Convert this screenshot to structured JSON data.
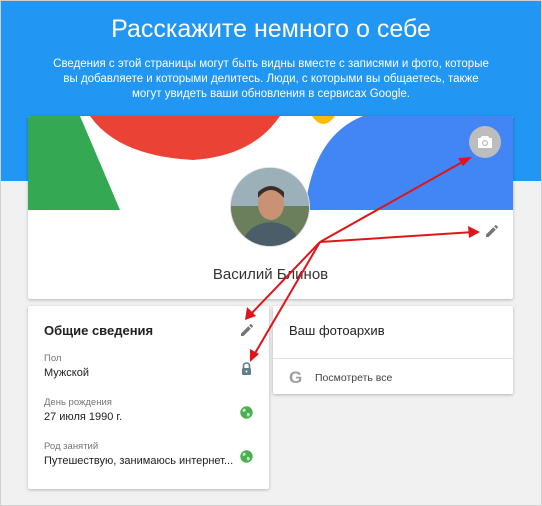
{
  "header": {
    "title": "Расскажите немного о себе",
    "description": "Сведения с этой страницы могут быть видны вместе с записями и фото, которые вы добавляете и которыми делитесь. Люди, с которыми вы общаетесь, также могут увидеть ваши обновления в сервисах Google."
  },
  "profile": {
    "name": "Василий Блинов",
    "avatar_icon": "user-photo",
    "change_cover_icon": "camera-icon",
    "edit_icon": "pencil-icon"
  },
  "general": {
    "title": "Общие сведения",
    "edit_icon": "pencil-icon",
    "fields": [
      {
        "label": "Пол",
        "value": "Мужской",
        "visibility_icon": "lock-icon"
      },
      {
        "label": "День рождения",
        "value": "27 июля 1990 г.",
        "visibility_icon": "globe-icon"
      },
      {
        "label": "Род занятий",
        "value": "Путешествую, занимаюсь интернет...",
        "visibility_icon": "globe-icon"
      }
    ]
  },
  "photos": {
    "title": "Ваш фотоархив",
    "logo_letter": "G",
    "link_label": "Посмотреть все"
  },
  "colors": {
    "header_bg": "#2196f3",
    "page_bg": "#f1f1f1",
    "cover_green": "#34a853",
    "cover_red": "#ea4335",
    "cover_blue": "#4285f4",
    "cover_yellow": "#fbbc05",
    "annotation_arrow": "#e0151b",
    "icon_grey": "#757575",
    "globe_green": "#4caf50"
  }
}
